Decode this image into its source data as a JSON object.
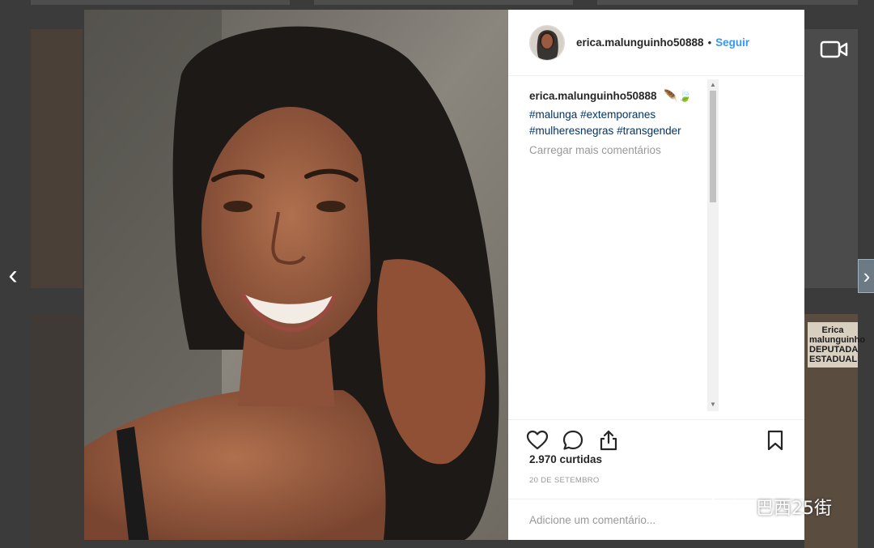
{
  "navigation": {
    "prev_glyph": "‹",
    "next_glyph": "›"
  },
  "background": {
    "poster_text": "Erica\nmalunguinho\nDEPUTADA\nESTADUAL"
  },
  "post": {
    "header": {
      "username": "erica.malunguinho50888",
      "separator": "•",
      "follow_label": "Seguir"
    },
    "caption": {
      "username": "erica.malunguinho50888",
      "emoji": "🪶🍃",
      "hashtags": [
        "#malunga",
        "#extemporanes",
        "#mulheresnegras",
        "#transgender"
      ]
    },
    "load_more_label": "Carregar mais comentários",
    "actions": {
      "like_icon": "heart-icon",
      "comment_icon": "comment-icon",
      "share_icon": "share-icon",
      "save_icon": "bookmark-icon"
    },
    "likes_text": "2.970 curtidas",
    "date_text": "20 DE SETEMBRO",
    "comment_placeholder": "Adicione um comentário..."
  },
  "watermark": {
    "text": "巴西25街"
  },
  "colors": {
    "link_blue": "#3897f0",
    "hashtag_navy": "#003569",
    "muted_gray": "#999999",
    "text_dark": "#262626"
  }
}
